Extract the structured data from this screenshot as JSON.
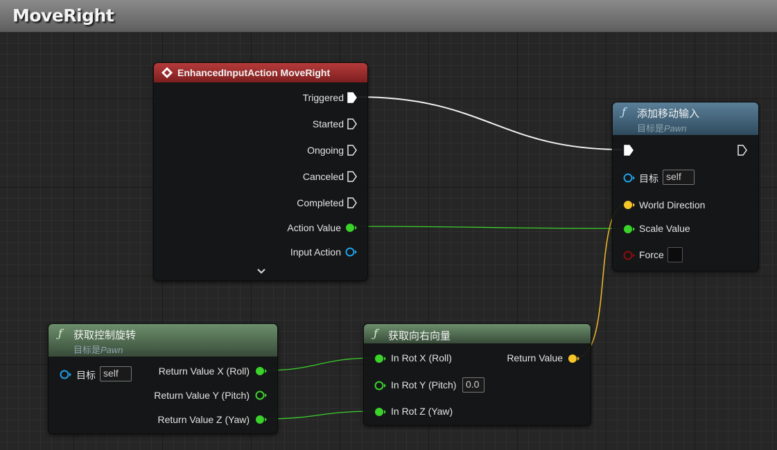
{
  "window": {
    "title": "MoveRight"
  },
  "nodes": {
    "input_action": {
      "title": "EnhancedInputAction MoveRight",
      "pins": {
        "triggered": "Triggered",
        "started": "Started",
        "ongoing": "Ongoing",
        "canceled": "Canceled",
        "completed": "Completed",
        "action_value": "Action Value",
        "input_action": "Input Action"
      }
    },
    "add_movement": {
      "title": "添加移动输入",
      "subtitle_prefix": "目标是",
      "subtitle_class": "Pawn",
      "pins": {
        "target": "目标",
        "target_value": "self",
        "world_direction": "World Direction",
        "scale_value": "Scale Value",
        "force": "Force"
      }
    },
    "get_control_rotation": {
      "title": "获取控制旋转",
      "subtitle_prefix": "目标是",
      "subtitle_class": "Pawn",
      "pins": {
        "target": "目标",
        "target_value": "self",
        "return_x": "Return Value X (Roll)",
        "return_y": "Return Value Y (Pitch)",
        "return_z": "Return Value Z (Yaw)"
      }
    },
    "get_right_vector": {
      "title": "获取向右向量",
      "pins": {
        "in_rot_x": "In Rot X (Roll)",
        "in_rot_y": "In Rot Y (Pitch)",
        "in_rot_y_value": "0.0",
        "in_rot_z": "In Rot Z (Yaw)",
        "return_value": "Return Value"
      }
    }
  },
  "colors": {
    "exec": "#ffffff",
    "float": "#3bd22b",
    "vector": "#f5c52a",
    "object": "#1ea0e6",
    "bool": "#8a0d0d",
    "event_header": "#9a2e2e",
    "function_header": "#47677c",
    "pure_header": "#52705a"
  },
  "icons": {
    "event": "event-diamond-icon",
    "function": "function-f-icon",
    "expand": "chevron-down-icon"
  }
}
